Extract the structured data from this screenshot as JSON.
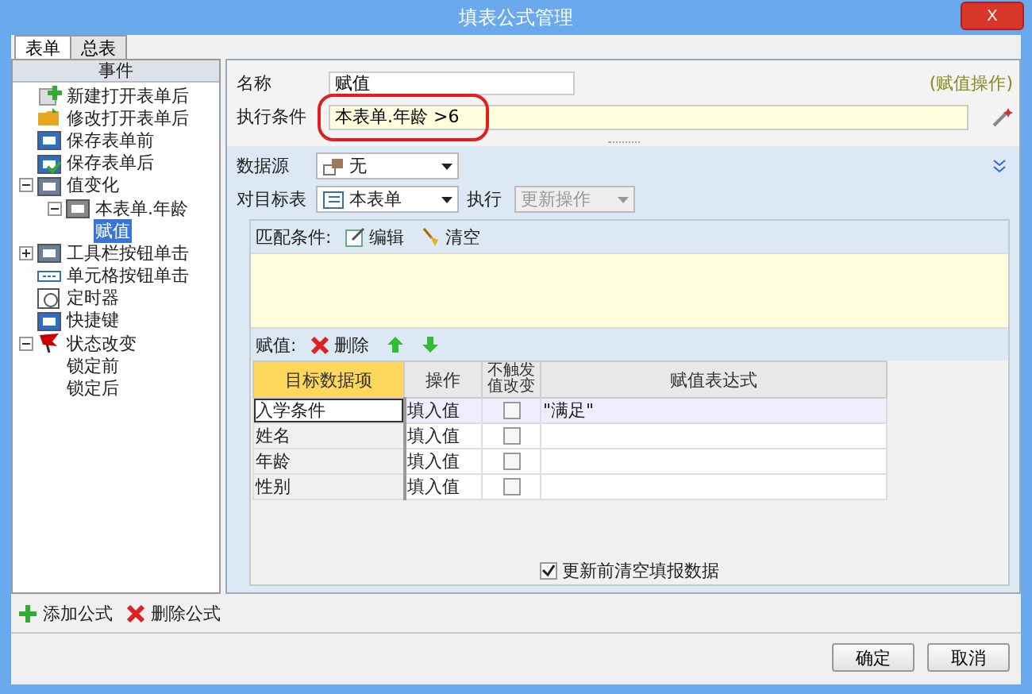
{
  "window": {
    "title": "填表公式管理",
    "close": "X"
  },
  "tabs": [
    {
      "label": "表单",
      "selected": true
    },
    {
      "label": "总表",
      "selected": false
    }
  ],
  "events": {
    "header": "事件",
    "items": [
      {
        "label": "新建打开表单后",
        "kind": "new",
        "selected": false
      },
      {
        "label": "修改打开表单后",
        "kind": "folder",
        "selected": false
      },
      {
        "label": "保存表单前",
        "kind": "save",
        "selected": false
      },
      {
        "label": "保存表单后",
        "kind": "saved",
        "selected": false
      },
      {
        "label": "值变化",
        "kind": "change",
        "selected": false,
        "expanded": true,
        "children": [
          {
            "label": "本表单.年龄",
            "kind": "field",
            "selected": false,
            "expanded": true,
            "children": [
              {
                "label": "赋值",
                "selected": true
              }
            ]
          }
        ]
      },
      {
        "label": "工具栏按钮单击",
        "kind": "toolbar",
        "selected": false,
        "expanded": false
      },
      {
        "label": "单元格按钮单击",
        "kind": "cellbutton",
        "selected": false
      },
      {
        "label": "定时器",
        "kind": "timer",
        "selected": false
      },
      {
        "label": "快捷键",
        "kind": "shortcut",
        "selected": false
      },
      {
        "label": "状态改变",
        "kind": "flag",
        "selected": false,
        "expanded": true,
        "children": [
          {
            "label": "锁定前",
            "selected": false
          },
          {
            "label": "锁定后",
            "selected": false
          }
        ]
      }
    ]
  },
  "formula": {
    "name_label": "名称",
    "name": "赋值",
    "type_link": "(赋值操作)",
    "condition_label": "执行条件",
    "condition": "本表单.年龄 >6",
    "condition_highlighted": true,
    "source_label": "数据源",
    "source": "无",
    "target_label": "对目标表",
    "target": "本表单",
    "exec_label": "执行",
    "exec": "更新操作",
    "exec_disabled": true
  },
  "match": {
    "label": "匹配条件:",
    "edit": "编辑",
    "clear": "清空"
  },
  "assign": {
    "label": "赋值:",
    "delete": "删除",
    "columns": [
      "目标数据项",
      "操作",
      "不触发值改变",
      "赋值表达式"
    ],
    "rows": [
      {
        "target": "入学条件",
        "op": "填入值",
        "no_trigger": false,
        "expr": "\"满足\"",
        "selected": true
      },
      {
        "target": "姓名",
        "op": "填入值",
        "no_trigger": false,
        "selected": false
      },
      {
        "target": "年龄",
        "op": "填入值",
        "no_trigger": false,
        "selected": false
      },
      {
        "target": "性别",
        "op": "填入值",
        "no_trigger": false,
        "selected": false
      }
    ]
  },
  "clear_before_update": {
    "label": "更新前清空填报数据",
    "checked": true
  },
  "footer": {
    "add": "添加公式",
    "remove": "删除公式",
    "ok": "确定",
    "cancel": "取消"
  }
}
